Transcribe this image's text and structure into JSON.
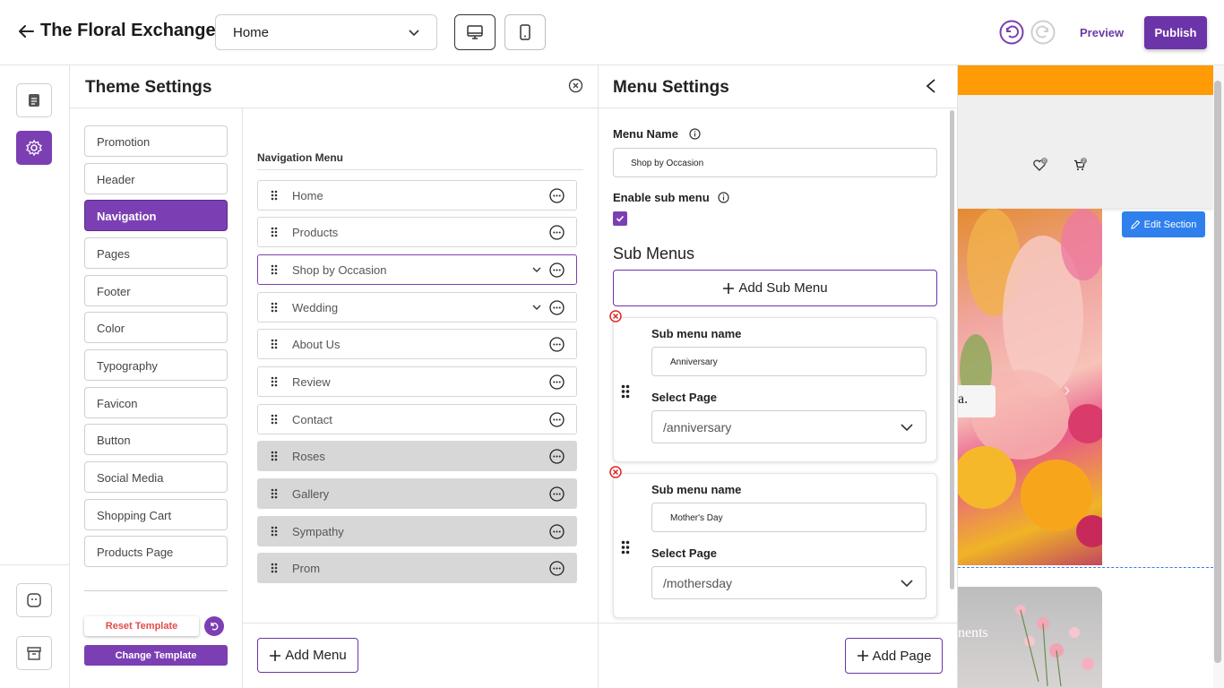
{
  "app": {
    "title": "The Floral Exchange",
    "page_select": "Home",
    "preview_label": "Preview",
    "publish_label": "Publish",
    "accent_color": "#7b3fb3"
  },
  "theme_panel": {
    "title": "Theme Settings",
    "categories": [
      "Promotion",
      "Header",
      "Navigation",
      "Pages",
      "Footer",
      "Color",
      "Typography",
      "Favicon",
      "Button",
      "Social Media",
      "Shopping Cart",
      "Products Page"
    ],
    "active_category": "Navigation",
    "reset_label": "Reset Template",
    "change_label": "Change Template"
  },
  "navigation": {
    "heading": "Navigation Menu",
    "items": [
      {
        "label": "Home",
        "state": "normal",
        "expandable": false
      },
      {
        "label": "Products",
        "state": "normal",
        "expandable": false
      },
      {
        "label": "Shop by Occasion",
        "state": "selected",
        "expandable": true
      },
      {
        "label": "Wedding",
        "state": "normal",
        "expandable": true
      },
      {
        "label": "About Us",
        "state": "normal",
        "expandable": false
      },
      {
        "label": "Review",
        "state": "normal",
        "expandable": false
      },
      {
        "label": "Contact",
        "state": "normal",
        "expandable": false
      },
      {
        "label": "Roses",
        "state": "disabled",
        "expandable": false
      },
      {
        "label": "Gallery",
        "state": "disabled",
        "expandable": false
      },
      {
        "label": "Sympathy",
        "state": "disabled",
        "expandable": false
      },
      {
        "label": "Prom",
        "state": "disabled",
        "expandable": false
      }
    ],
    "add_menu_label": "Add Menu"
  },
  "menu_settings": {
    "title": "Menu Settings",
    "menu_name_label": "Menu Name",
    "menu_name_value": "Shop by Occasion",
    "enable_sub_label": "Enable sub menu",
    "enable_sub_checked": true,
    "sub_menus_heading": "Sub Menus",
    "add_sub_label": "Add Sub Menu",
    "sub_menus": [
      {
        "name_label": "Sub menu name",
        "name_value": "Anniversary",
        "page_label": "Select Page",
        "page_value": "/anniversary"
      },
      {
        "name_label": "Sub menu name",
        "name_value": "Mother's Day",
        "page_label": "Select Page",
        "page_value": "/mothersday"
      }
    ],
    "add_page_label": "Add Page"
  },
  "preview": {
    "edit_section_label": "Edit Section",
    "wishlist_count": "0",
    "cart_count": "2",
    "hero_caption_fragment": "a.",
    "card_text_fragment": "nents",
    "promo_color": "#ff9b05"
  }
}
